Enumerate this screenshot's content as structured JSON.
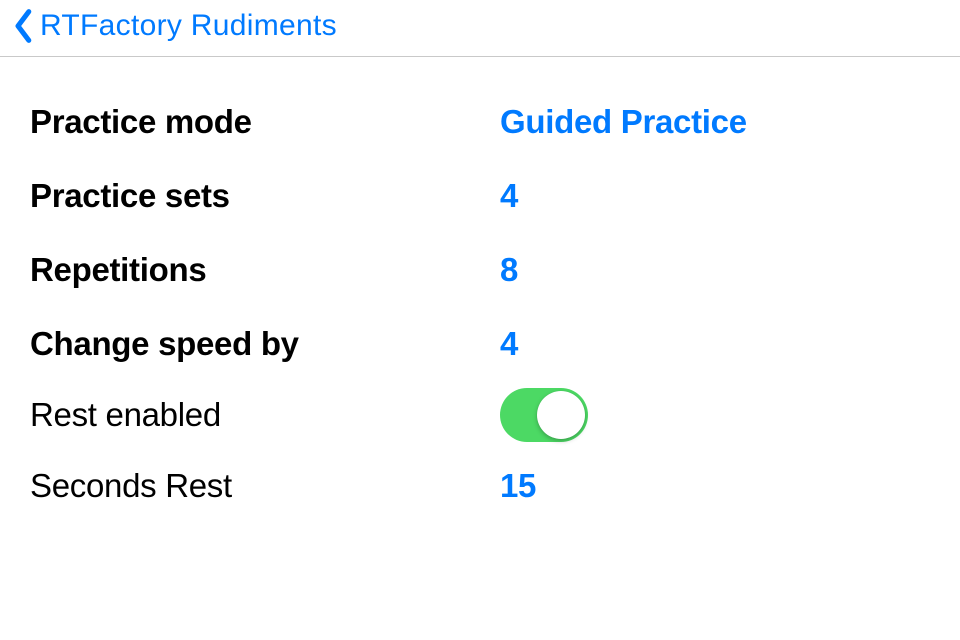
{
  "nav": {
    "back_title": "RTFactory Rudiments"
  },
  "settings": {
    "practice_mode": {
      "label": "Practice mode",
      "value": "Guided Practice"
    },
    "practice_sets": {
      "label": "Practice sets",
      "value": "4"
    },
    "repetitions": {
      "label": "Repetitions",
      "value": "8"
    },
    "change_speed_by": {
      "label": "Change speed by",
      "value": "4"
    },
    "rest_enabled": {
      "label": "Rest enabled",
      "on": true
    },
    "seconds_rest": {
      "label": "Seconds Rest",
      "value": "15"
    }
  },
  "colors": {
    "accent": "#007aff",
    "toggle_on": "#4cd964"
  }
}
